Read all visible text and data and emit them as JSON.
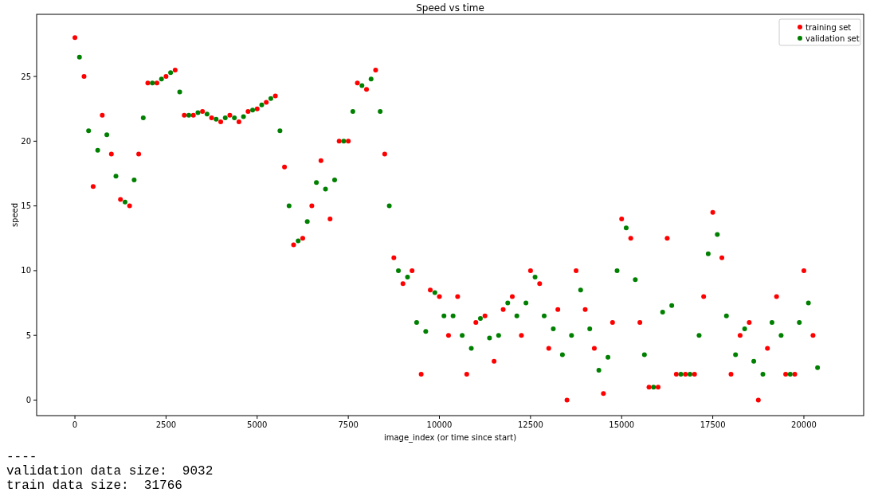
{
  "chart_data": {
    "type": "scatter",
    "title": "Speed vs time",
    "xlabel": "image_index (or time since start)",
    "ylabel": "speed",
    "xlim": [
      -1050,
      21640
    ],
    "ylim": [
      -1.2,
      29.8
    ],
    "xticks": [
      0,
      2500,
      5000,
      7500,
      10000,
      12500,
      15000,
      17500,
      20000
    ],
    "yticks": [
      0,
      5,
      10,
      15,
      20,
      25
    ],
    "legend": "upper right",
    "x": [
      0,
      125,
      250,
      375,
      500,
      625,
      750,
      875,
      1000,
      1125,
      1250,
      1375,
      1500,
      1625,
      1750,
      1875,
      2000,
      2125,
      2250,
      2375,
      2500,
      2625,
      2750,
      2875,
      3000,
      3125,
      3250,
      3375,
      3500,
      3625,
      3750,
      3875,
      4000,
      4125,
      4250,
      4375,
      4500,
      4625,
      4750,
      4875,
      5000,
      5125,
      5250,
      5375,
      5500,
      5625,
      5750,
      5875,
      6000,
      6125,
      6250,
      6375,
      6500,
      6625,
      6750,
      6875,
      7000,
      7125,
      7250,
      7375,
      7500,
      7625,
      7750,
      7875,
      8000,
      8125,
      8250,
      8375,
      8500,
      8625,
      8750,
      8875,
      9000,
      9125,
      9250,
      9375,
      9500,
      9625,
      9750,
      9875,
      10000,
      10125,
      10250,
      10375,
      10500,
      10625,
      10750,
      10875,
      11000,
      11125,
      11250,
      11375,
      11500,
      11625,
      11750,
      11875,
      12000,
      12125,
      12250,
      12375,
      12500,
      12625,
      12750,
      12875,
      13000,
      13125,
      13250,
      13375,
      13500,
      13625,
      13750,
      13875,
      14000,
      14125,
      14250,
      14375,
      14500,
      14625,
      14750,
      14875,
      15000,
      15125,
      15250,
      15375,
      15500,
      15625,
      15750,
      15875,
      16000,
      16125,
      16250,
      16375,
      16500,
      16625,
      16750,
      16875,
      17000,
      17125,
      17250,
      17375,
      17500,
      17625,
      17750,
      17875,
      18000,
      18125,
      18250,
      18375,
      18500,
      18625,
      18750,
      18875,
      19000,
      19125,
      19250,
      19375,
      19500,
      19625,
      19750,
      19875,
      20000,
      20125,
      20250,
      20375
    ],
    "series": [
      {
        "name": "training set",
        "color": "#ff0000",
        "values": [
          28,
          null,
          25,
          null,
          16.5,
          null,
          22,
          null,
          19,
          null,
          15.5,
          null,
          15,
          null,
          19,
          null,
          24.5,
          null,
          24.5,
          null,
          25,
          null,
          25.5,
          null,
          22,
          null,
          22,
          null,
          22.3,
          null,
          21.8,
          null,
          21.5,
          null,
          22,
          null,
          21.5,
          null,
          22.3,
          null,
          22.5,
          null,
          23,
          null,
          23.5,
          null,
          18,
          null,
          12,
          null,
          12.5,
          null,
          15,
          null,
          18.5,
          null,
          14,
          null,
          20,
          null,
          20,
          null,
          24.5,
          null,
          24,
          null,
          25.5,
          null,
          19,
          null,
          11,
          null,
          9,
          null,
          10,
          null,
          2,
          null,
          8.5,
          null,
          8,
          null,
          5,
          null,
          8,
          null,
          2,
          null,
          6,
          null,
          6.5,
          null,
          3,
          null,
          7,
          null,
          8,
          null,
          5,
          null,
          10,
          null,
          9,
          null,
          4,
          null,
          7,
          null,
          0,
          null,
          10,
          null,
          7,
          null,
          4,
          null,
          0.5,
          null,
          6,
          null,
          14,
          null,
          12.5,
          null,
          6,
          null,
          1,
          null,
          1,
          null,
          12.5,
          null,
          2,
          null,
          2,
          null,
          2,
          null,
          8,
          null,
          14.5,
          null,
          11,
          null,
          2,
          null,
          5,
          null,
          6,
          null,
          0,
          null,
          4,
          null,
          8,
          null,
          2,
          null,
          2,
          null,
          10,
          null,
          5,
          null
        ]
      },
      {
        "name": "validation set",
        "color": "#008000",
        "values": [
          null,
          26.5,
          null,
          20.8,
          null,
          19.3,
          null,
          20.5,
          null,
          17.3,
          null,
          15.3,
          null,
          17,
          null,
          21.8,
          null,
          24.5,
          null,
          24.8,
          null,
          25.3,
          null,
          23.8,
          null,
          22,
          null,
          22.2,
          null,
          22.1,
          null,
          21.7,
          null,
          21.8,
          null,
          21.8,
          null,
          21.9,
          null,
          22.4,
          null,
          22.8,
          null,
          23.3,
          null,
          20.8,
          null,
          15,
          null,
          12.3,
          null,
          13.8,
          null,
          16.8,
          null,
          16.3,
          null,
          17,
          null,
          20,
          null,
          22.3,
          null,
          24.3,
          null,
          24.8,
          null,
          22.3,
          null,
          15,
          null,
          10,
          null,
          9.5,
          null,
          6,
          null,
          5.3,
          null,
          8.3,
          null,
          6.5,
          null,
          6.5,
          null,
          5,
          null,
          4,
          null,
          6.3,
          null,
          4.8,
          null,
          5,
          null,
          7.5,
          null,
          6.5,
          null,
          7.5,
          null,
          9.5,
          null,
          6.5,
          null,
          5.5,
          null,
          3.5,
          null,
          5,
          null,
          8.5,
          null,
          5.5,
          null,
          2.3,
          null,
          3.3,
          null,
          10,
          null,
          13.3,
          null,
          9.3,
          null,
          3.5,
          null,
          1,
          null,
          6.8,
          null,
          7.3,
          null,
          2,
          null,
          2,
          null,
          5,
          null,
          11.3,
          null,
          12.8,
          null,
          6.5,
          null,
          3.5,
          null,
          5.5,
          null,
          3,
          null,
          2,
          null,
          6,
          null,
          5,
          null,
          2,
          null,
          6,
          null,
          7.5,
          null,
          2.5
        ]
      }
    ]
  },
  "output_lines": [
    "----",
    "validation data size:  9032",
    "train data size:  31766"
  ]
}
